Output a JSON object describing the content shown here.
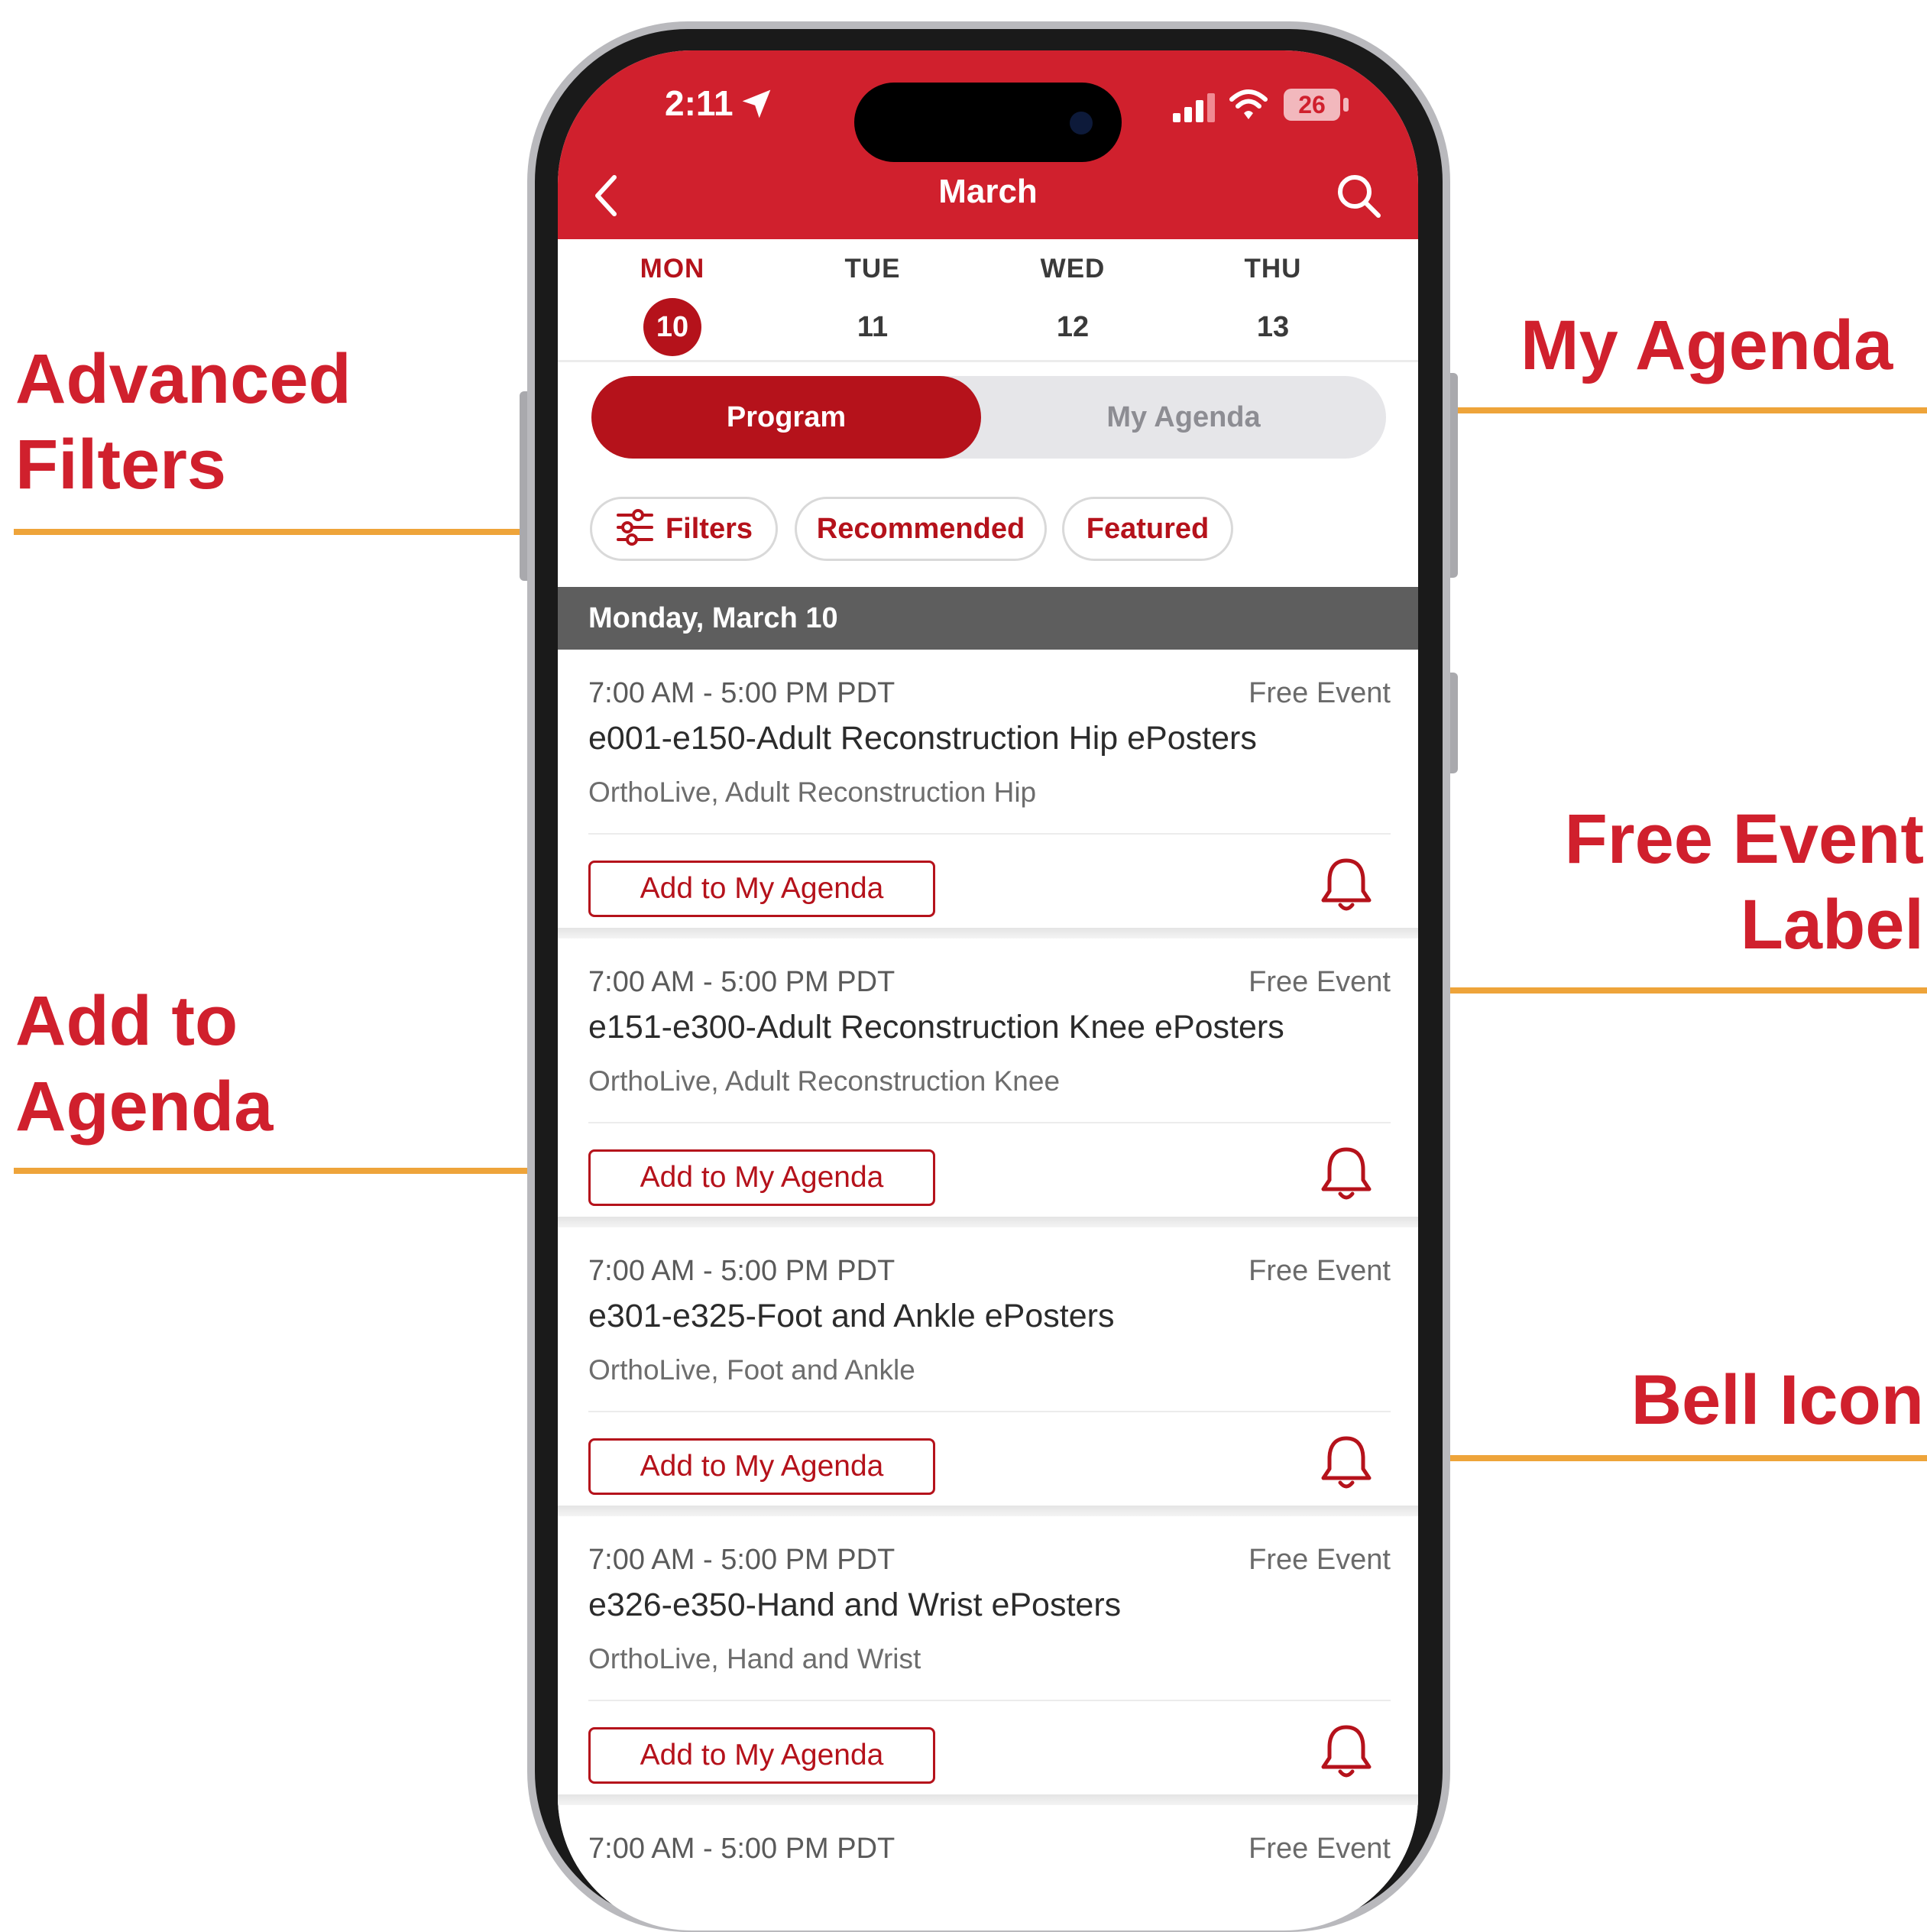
{
  "callouts": {
    "advanced_filters": "Advanced\nFilters",
    "my_agenda": "My Agenda",
    "free_event_label": "Free Event\nLabel",
    "add_to_agenda": "Add to\nAgenda",
    "bell_icon": "Bell Icon"
  },
  "status_bar": {
    "time": "2:11",
    "battery": "26"
  },
  "nav": {
    "title": "March"
  },
  "days": [
    {
      "name": "MON",
      "num": "10"
    },
    {
      "name": "TUE",
      "num": "11"
    },
    {
      "name": "WED",
      "num": "12"
    },
    {
      "name": "THU",
      "num": "13"
    }
  ],
  "segment": {
    "program": "Program",
    "my_agenda": "My Agenda"
  },
  "chips": {
    "filters": "Filters",
    "recommended": "Recommended",
    "featured": "Featured"
  },
  "section_header": "Monday, March 10",
  "events": [
    {
      "time": "7:00 AM - 5:00 PM PDT",
      "free": "Free Event",
      "title": "e001-e150-Adult Reconstruction Hip ePosters",
      "track": "OrthoLive, Adult Reconstruction Hip",
      "add": "Add to My Agenda"
    },
    {
      "time": "7:00 AM - 5:00 PM PDT",
      "free": "Free Event",
      "title": "e151-e300-Adult Reconstruction Knee ePosters",
      "track": "OrthoLive, Adult Reconstruction Knee",
      "add": "Add to My Agenda"
    },
    {
      "time": "7:00 AM - 5:00 PM PDT",
      "free": "Free Event",
      "title": "e301-e325-Foot and Ankle ePosters",
      "track": "OrthoLive, Foot and Ankle",
      "add": "Add to My Agenda"
    },
    {
      "time": "7:00 AM - 5:00 PM PDT",
      "free": "Free Event",
      "title": "e326-e350-Hand and Wrist ePosters",
      "track": "OrthoLive, Hand and Wrist",
      "add": "Add to My Agenda"
    },
    {
      "time": "7:00 AM - 5:00 PM PDT",
      "free": "Free Event"
    }
  ],
  "colors": {
    "brand_red": "#d0202d",
    "button_red": "#b5121b",
    "callout_orange": "#eea43a"
  },
  "icons": [
    "location-arrow-icon",
    "signal-icon",
    "wifi-icon",
    "back-chevron-icon",
    "search-icon",
    "filter-sliders-icon",
    "bell-icon"
  ]
}
